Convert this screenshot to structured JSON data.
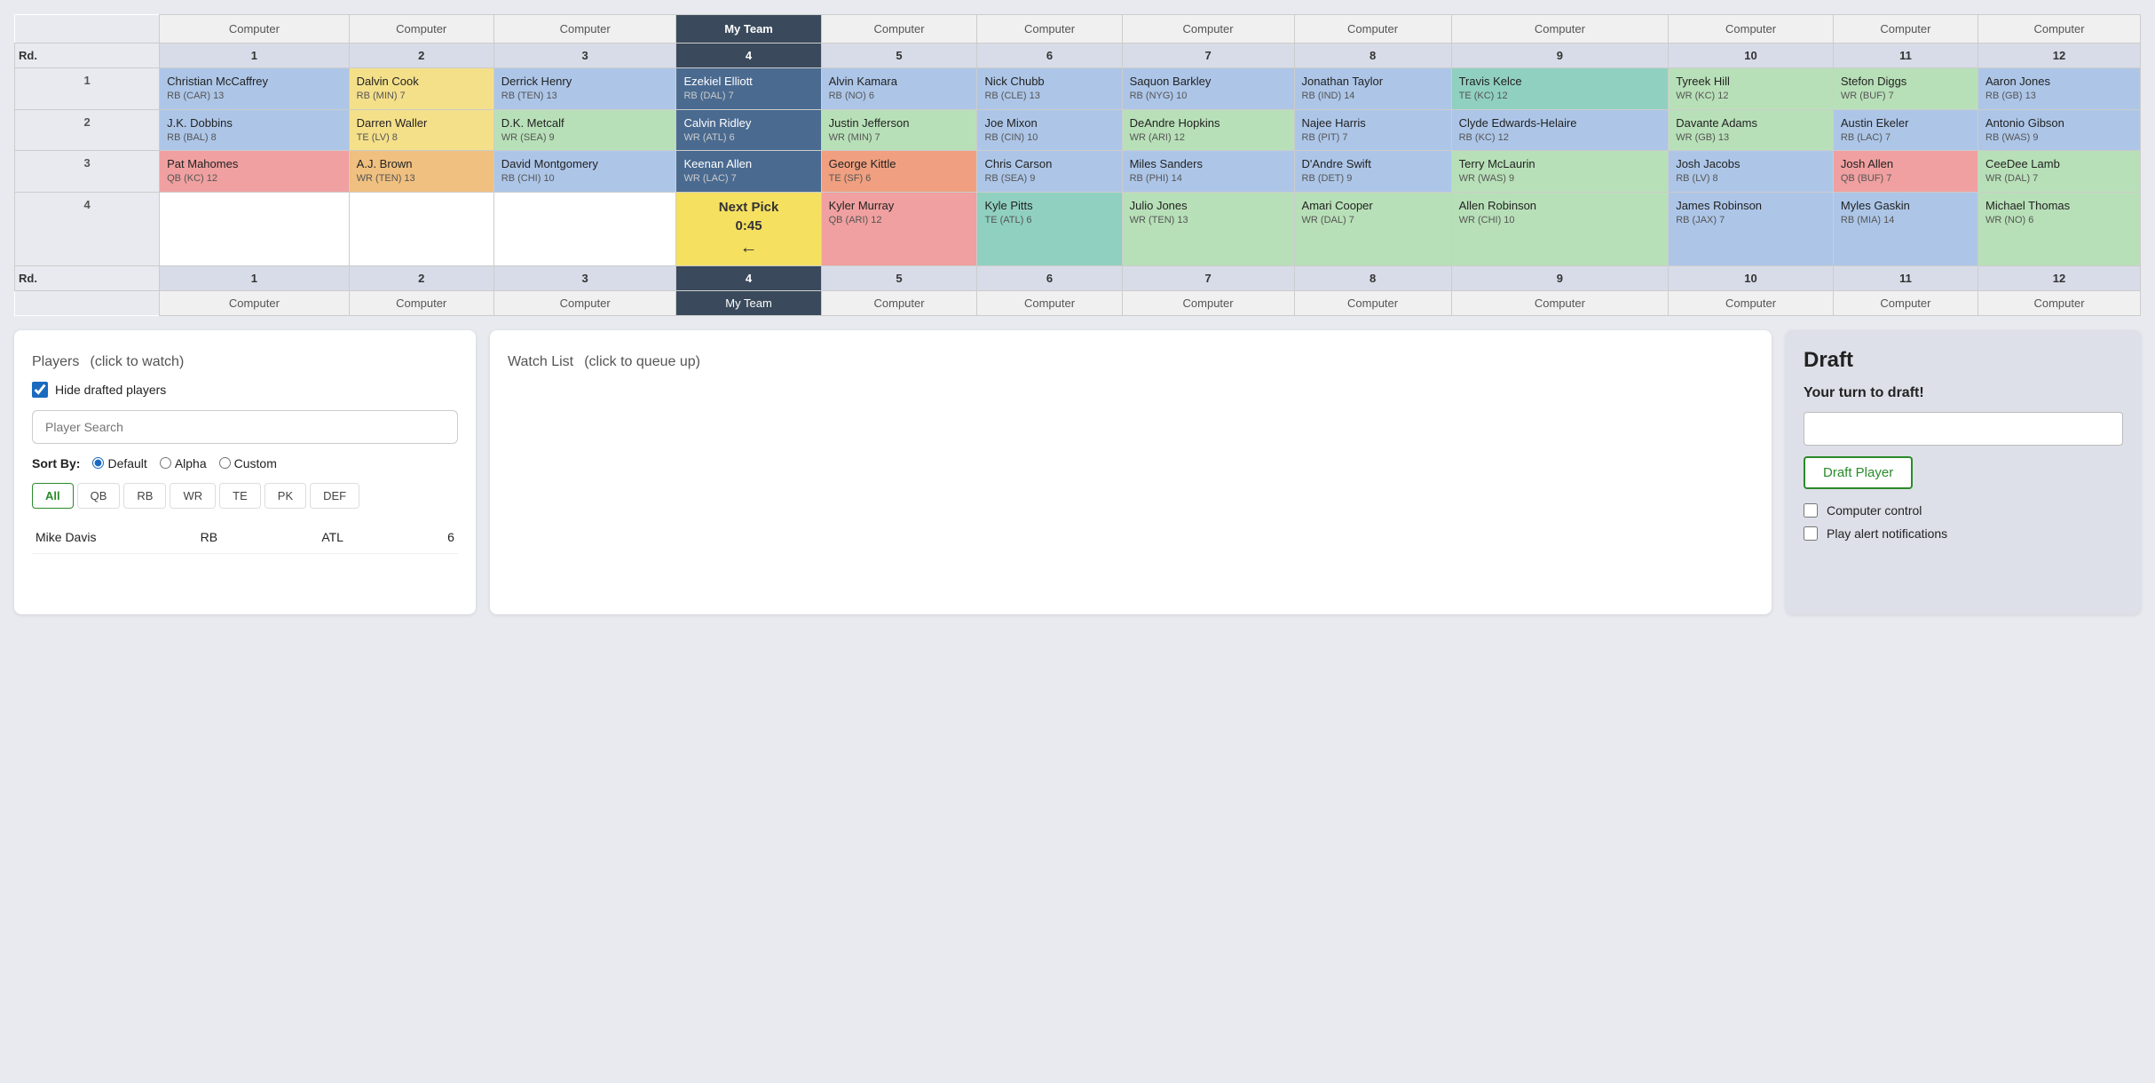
{
  "table": {
    "headers": [
      "",
      "Computer",
      "Computer",
      "Computer",
      "My Team",
      "Computer",
      "Computer",
      "Computer",
      "Computer",
      "Computer",
      "Computer",
      "Computer",
      "Computer"
    ],
    "rounds": [
      "Rd.",
      "1",
      "2",
      "3",
      "4",
      "Rd."
    ],
    "col_numbers": [
      "",
      "1",
      "2",
      "3",
      "4",
      "5",
      "6",
      "7",
      "8",
      "9",
      "10",
      "11",
      "12"
    ],
    "rows": [
      {
        "round": "1",
        "cells": [
          {
            "name": "Christian McCaffrey",
            "pos": "RB",
            "team": "CAR",
            "num": "13",
            "color": "blue"
          },
          {
            "name": "Dalvin Cook",
            "pos": "RB",
            "team": "MIN",
            "num": "7",
            "color": "yellow"
          },
          {
            "name": "Derrick Henry",
            "pos": "RB",
            "team": "TEN",
            "num": "13",
            "color": "blue"
          },
          {
            "name": "Ezekiel Elliott",
            "pos": "RB",
            "team": "DAL",
            "num": "7",
            "color": "myteam"
          },
          {
            "name": "Alvin Kamara",
            "pos": "RB",
            "team": "NO",
            "num": "6",
            "color": "blue"
          },
          {
            "name": "Nick Chubb",
            "pos": "RB",
            "team": "CLE",
            "num": "13",
            "color": "blue"
          },
          {
            "name": "Saquon Barkley",
            "pos": "RB",
            "team": "NYG",
            "num": "10",
            "color": "blue"
          },
          {
            "name": "Jonathan Taylor",
            "pos": "RB",
            "team": "IND",
            "num": "14",
            "color": "blue"
          },
          {
            "name": "Travis Kelce",
            "pos": "TE",
            "team": "KC",
            "num": "12",
            "color": "teal"
          },
          {
            "name": "Tyreek Hill",
            "pos": "WR",
            "team": "KC",
            "num": "12",
            "color": "green"
          },
          {
            "name": "Stefon Diggs",
            "pos": "WR",
            "team": "BUF",
            "num": "7",
            "color": "green"
          },
          {
            "name": "Aaron Jones",
            "pos": "RB",
            "team": "GB",
            "num": "13",
            "color": "blue"
          }
        ]
      },
      {
        "round": "2",
        "cells": [
          {
            "name": "J.K. Dobbins",
            "pos": "RB",
            "team": "BAL",
            "num": "8",
            "color": "blue"
          },
          {
            "name": "Darren Waller",
            "pos": "TE",
            "team": "LV",
            "num": "8",
            "color": "yellow"
          },
          {
            "name": "D.K. Metcalf",
            "pos": "WR",
            "team": "SEA",
            "num": "9",
            "color": "green"
          },
          {
            "name": "Calvin Ridley",
            "pos": "WR",
            "team": "ATL",
            "num": "6",
            "color": "myteam"
          },
          {
            "name": "Justin Jefferson",
            "pos": "WR",
            "team": "MIN",
            "num": "7",
            "color": "green"
          },
          {
            "name": "Joe Mixon",
            "pos": "RB",
            "team": "CIN",
            "num": "10",
            "color": "blue"
          },
          {
            "name": "DeAndre Hopkins",
            "pos": "WR",
            "team": "ARI",
            "num": "12",
            "color": "green"
          },
          {
            "name": "Najee Harris",
            "pos": "RB",
            "team": "PIT",
            "num": "7",
            "color": "blue"
          },
          {
            "name": "Clyde Edwards-Helaire",
            "pos": "RB",
            "team": "KC",
            "num": "12",
            "color": "blue"
          },
          {
            "name": "Davante Adams",
            "pos": "WR",
            "team": "GB",
            "num": "13",
            "color": "green"
          },
          {
            "name": "Austin Ekeler",
            "pos": "RB",
            "team": "LAC",
            "num": "7",
            "color": "blue"
          },
          {
            "name": "Antonio Gibson",
            "pos": "RB",
            "team": "WAS",
            "num": "9",
            "color": "blue"
          }
        ]
      },
      {
        "round": "3",
        "cells": [
          {
            "name": "Pat Mahomes",
            "pos": "QB",
            "team": "KC",
            "num": "12",
            "color": "red"
          },
          {
            "name": "A.J. Brown",
            "pos": "WR",
            "team": "TEN",
            "num": "13",
            "color": "orange"
          },
          {
            "name": "David Montgomery",
            "pos": "RB",
            "team": "CHI",
            "num": "10",
            "color": "blue"
          },
          {
            "name": "Keenan Allen",
            "pos": "WR",
            "team": "LAC",
            "num": "7",
            "color": "myteam"
          },
          {
            "name": "George Kittle",
            "pos": "TE",
            "team": "SF",
            "num": "6",
            "color": "salmon"
          },
          {
            "name": "Chris Carson",
            "pos": "RB",
            "team": "SEA",
            "num": "9",
            "color": "blue"
          },
          {
            "name": "Miles Sanders",
            "pos": "RB",
            "team": "PHI",
            "num": "14",
            "color": "blue"
          },
          {
            "name": "D'Andre Swift",
            "pos": "RB",
            "team": "DET",
            "num": "9",
            "color": "blue"
          },
          {
            "name": "Terry McLaurin",
            "pos": "WR",
            "team": "WAS",
            "num": "9",
            "color": "green"
          },
          {
            "name": "Josh Jacobs",
            "pos": "RB",
            "team": "LV",
            "num": "8",
            "color": "blue"
          },
          {
            "name": "Josh Allen",
            "pos": "QB",
            "team": "BUF",
            "num": "7",
            "color": "red"
          },
          {
            "name": "CeeDee Lamb",
            "pos": "WR",
            "team": "DAL",
            "num": "7",
            "color": "green"
          }
        ]
      },
      {
        "round": "4",
        "cells": [
          {
            "name": "",
            "pos": "",
            "team": "",
            "num": "",
            "color": "empty"
          },
          {
            "name": "",
            "pos": "",
            "team": "",
            "num": "",
            "color": "empty"
          },
          {
            "name": "",
            "pos": "",
            "team": "",
            "num": "",
            "color": "empty"
          },
          {
            "name": "NEXT_PICK",
            "pos": "",
            "team": "",
            "num": "",
            "color": "next"
          },
          {
            "name": "Kyler Murray",
            "pos": "QB",
            "team": "ARI",
            "num": "12",
            "color": "red"
          },
          {
            "name": "Kyle Pitts",
            "pos": "TE",
            "team": "ATL",
            "num": "6",
            "color": "teal"
          },
          {
            "name": "Julio Jones",
            "pos": "WR",
            "team": "TEN",
            "num": "13",
            "color": "green"
          },
          {
            "name": "Amari Cooper",
            "pos": "WR",
            "team": "DAL",
            "num": "7",
            "color": "green"
          },
          {
            "name": "Allen Robinson",
            "pos": "WR",
            "team": "CHI",
            "num": "10",
            "color": "green"
          },
          {
            "name": "James Robinson",
            "pos": "RB",
            "team": "JAX",
            "num": "7",
            "color": "blue"
          },
          {
            "name": "Myles Gaskin",
            "pos": "RB",
            "team": "MIA",
            "num": "14",
            "color": "blue"
          },
          {
            "name": "Michael Thomas",
            "pos": "WR",
            "team": "NO",
            "num": "6",
            "color": "green"
          }
        ]
      }
    ]
  },
  "players_panel": {
    "title": "Players",
    "subtitle": "(click to watch)",
    "hide_drafted_label": "Hide drafted players",
    "hide_drafted_checked": true,
    "search_placeholder": "Player Search",
    "sort_by_label": "Sort By:",
    "sort_options": [
      {
        "label": "Default",
        "value": "default",
        "selected": true
      },
      {
        "label": "Alpha",
        "value": "alpha",
        "selected": false
      },
      {
        "label": "Custom",
        "value": "custom",
        "selected": false
      }
    ],
    "filter_tabs": [
      {
        "label": "All",
        "active": true
      },
      {
        "label": "QB",
        "active": false
      },
      {
        "label": "RB",
        "active": false
      },
      {
        "label": "WR",
        "active": false
      },
      {
        "label": "TE",
        "active": false
      },
      {
        "label": "PK",
        "active": false
      },
      {
        "label": "DEF",
        "active": false
      }
    ],
    "player": {
      "name": "Mike Davis",
      "pos": "RB",
      "team": "ATL",
      "num": "6"
    }
  },
  "watchlist_panel": {
    "title": "Watch List",
    "subtitle": "(click to queue up)"
  },
  "draft_panel": {
    "title": "Draft",
    "your_turn_label": "Your turn to draft!",
    "draft_button_label": "Draft Player",
    "computer_control_label": "Computer control",
    "play_alert_label": "Play alert notifications",
    "computer_control_checked": false,
    "play_alert_checked": false
  },
  "colors": {
    "blue": "#adc6e8",
    "green": "#b8e0b8",
    "yellow": "#f5e08a",
    "red": "#f0a0a0",
    "orange": "#f0c080",
    "myteam_header": "#3a4a5c",
    "myteam_cell": "#4a6080",
    "teal": "#90d0c0",
    "salmon": "#f0a080",
    "next": "#f5e060",
    "empty": "#ffffff"
  }
}
